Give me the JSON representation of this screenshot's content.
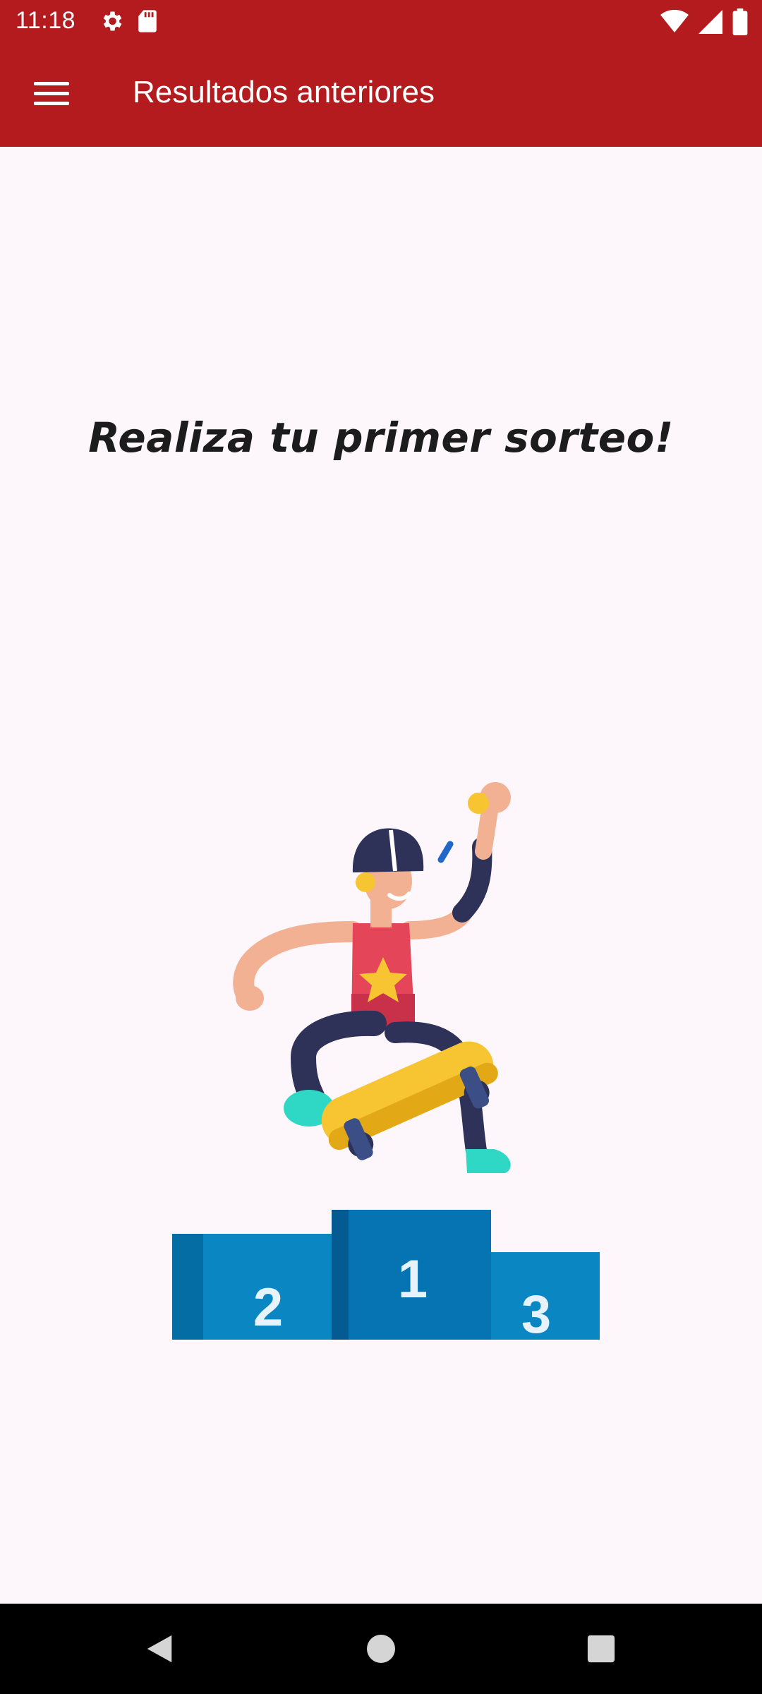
{
  "status_bar": {
    "time": "11:18",
    "left_icons": [
      "settings-icon",
      "sd-card-icon"
    ],
    "right_icons": [
      "wifi-icon",
      "signal-icon",
      "battery-icon"
    ]
  },
  "app_bar": {
    "menu_icon": "menu-icon",
    "title": "Resultados anteriores"
  },
  "main": {
    "headline": "Realiza tu primer sorteo!",
    "illustration": {
      "name": "skater-on-podium",
      "podium_labels": [
        "2",
        "1",
        "3"
      ]
    }
  },
  "nav_bar": {
    "buttons": [
      "back-icon",
      "home-icon",
      "recents-icon"
    ]
  },
  "colors": {
    "primary": "#b31b1e",
    "background": "#fdf7fc",
    "podium_blue": "#0a86c2"
  }
}
